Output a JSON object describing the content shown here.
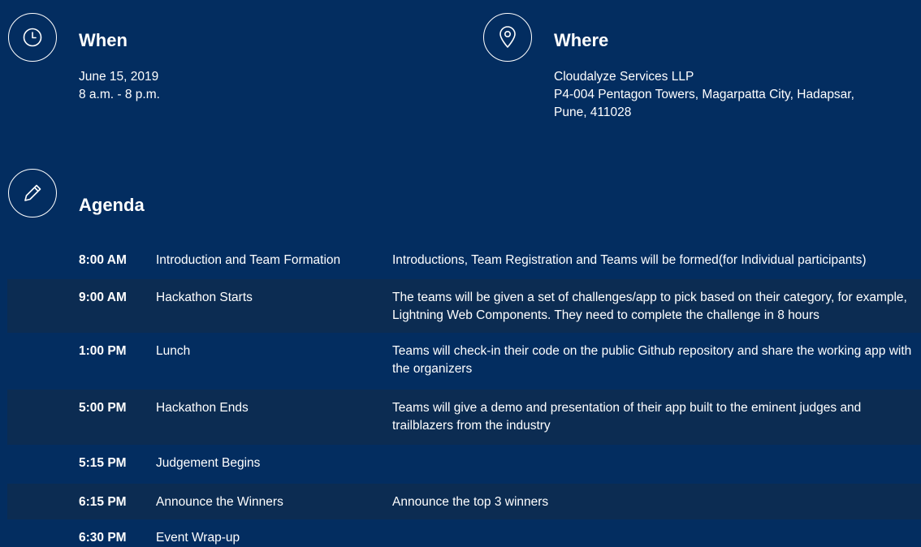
{
  "when": {
    "icon": "clock-icon",
    "heading": "When",
    "date": "June 15, 2019",
    "time": "8 a.m. - 8 p.m."
  },
  "where": {
    "icon": "location-pin-icon",
    "heading": "Where",
    "line1": "Cloudalyze Services LLP",
    "line2": "P4-004 Pentagon Towers, Magarpatta City, Hadapsar,",
    "line3": "Pune, 411028"
  },
  "agenda": {
    "icon": "pencil-icon",
    "heading": "Agenda",
    "items": [
      {
        "time": "8:00 AM",
        "title": "Introduction and Team Formation",
        "description": "Introductions, Team Registration and Teams will be formed(for Individual participants)"
      },
      {
        "time": "9:00 AM",
        "title": "Hackathon Starts",
        "description": "The teams will be given a set of challenges/app to pick based on their category, for example, Lightning Web Components. They need to complete the challenge in 8 hours"
      },
      {
        "time": "1:00 PM",
        "title": "Lunch",
        "description": "Teams will check-in their code on the public Github repository and share the working app with the organizers"
      },
      {
        "time": "5:00 PM",
        "title": "Hackathon Ends",
        "description": "Teams will give a demo and presentation of their app built to the eminent judges and trailblazers from the industry"
      },
      {
        "time": "5:15 PM",
        "title": "Judgement Begins",
        "description": ""
      },
      {
        "time": "6:15 PM",
        "title": "Announce the Winners",
        "description": "Announce the top 3 winners"
      },
      {
        "time": "6:30 PM",
        "title": "Event Wrap-up",
        "description": ""
      }
    ]
  },
  "colors": {
    "background": "#032d60",
    "shaded_row": "#0c2c52",
    "text": "#ffffff"
  }
}
